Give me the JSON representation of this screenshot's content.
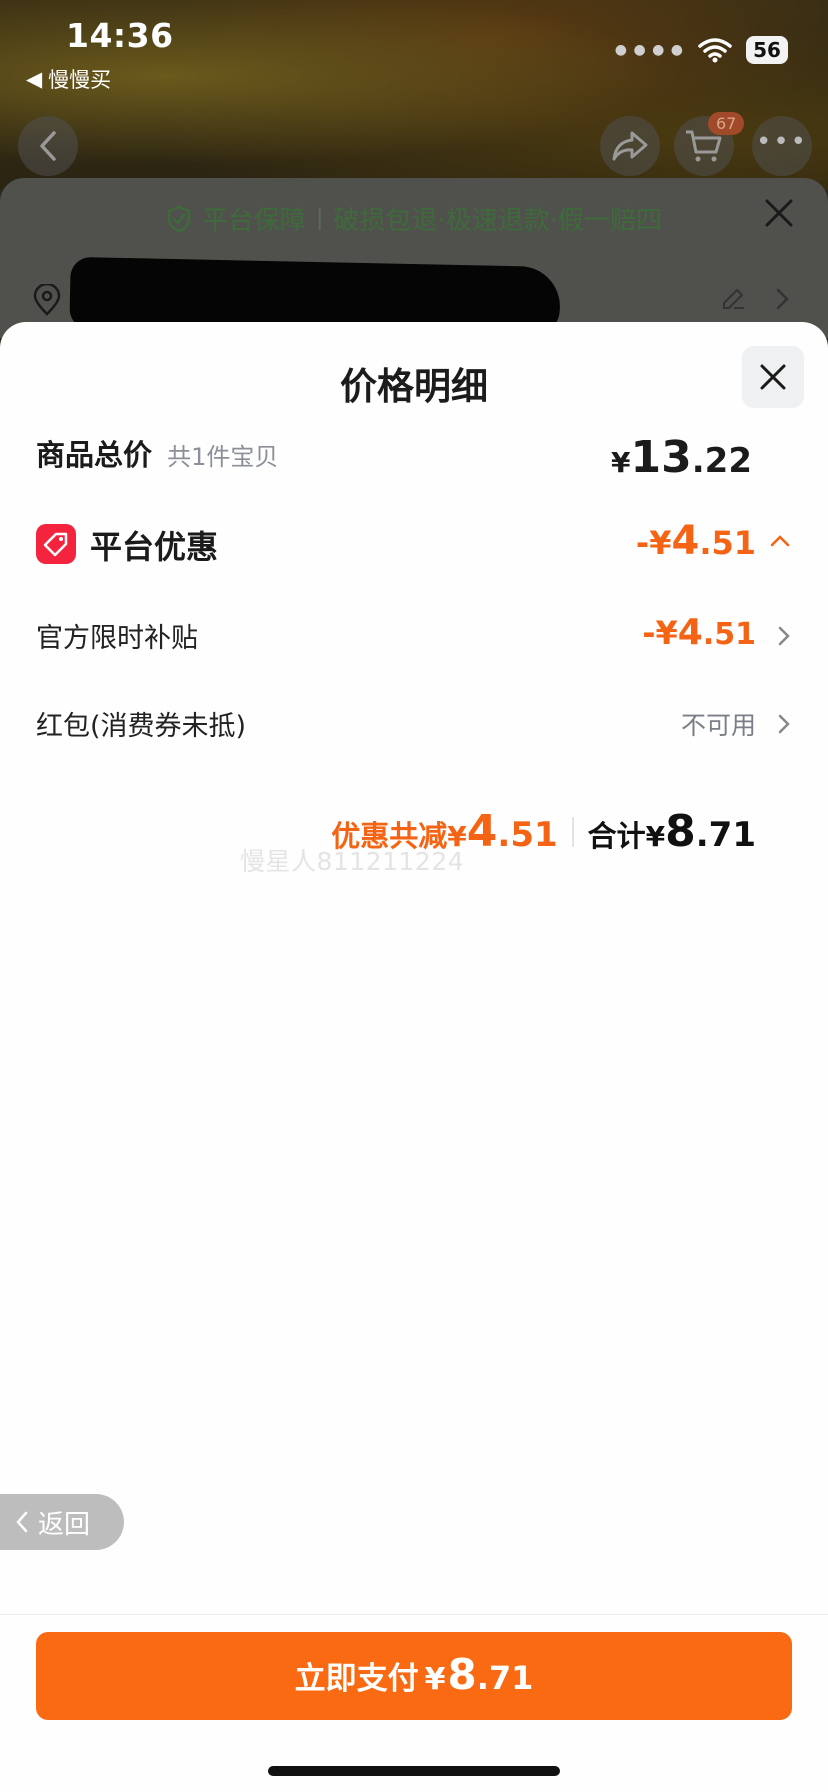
{
  "status_bar": {
    "time": "14:36",
    "back_app": "慢慢买",
    "battery": "56"
  },
  "top_nav": {
    "cart_badge": "67"
  },
  "guarantee_banner": {
    "title": "平台保障",
    "detail": "破损包退·极速退款·假一赔四"
  },
  "sheet": {
    "title": "价格明细",
    "total_row": {
      "label": "商品总价",
      "sub": "共1件宝贝",
      "currency": "¥",
      "int": "13",
      "dec": ".22"
    },
    "platform_row": {
      "label": "平台优惠",
      "sign": "-¥",
      "int": "4",
      "dec": ".51"
    },
    "subsidy_row": {
      "label": "官方限时补贴",
      "sign": "-¥",
      "int": "4",
      "dec": ".51"
    },
    "redpacket_row": {
      "label": "红包(消费券未抵)",
      "status": "不可用"
    },
    "summary": {
      "discount_label": "优惠共减",
      "discount_currency": "¥",
      "discount_int": "4",
      "discount_dec": ".51",
      "total_label": "合计",
      "total_currency": "¥",
      "total_int": "8",
      "total_dec": ".71"
    },
    "watermark": "慢星人811211224"
  },
  "back_pill": {
    "label": "返回"
  },
  "pay_button": {
    "label": "立即支付",
    "currency": "¥",
    "int": "8",
    "dec": ".71"
  },
  "colors": {
    "accent": "#fa6a12",
    "discount": "#f56414",
    "tag": "#f5243e"
  }
}
